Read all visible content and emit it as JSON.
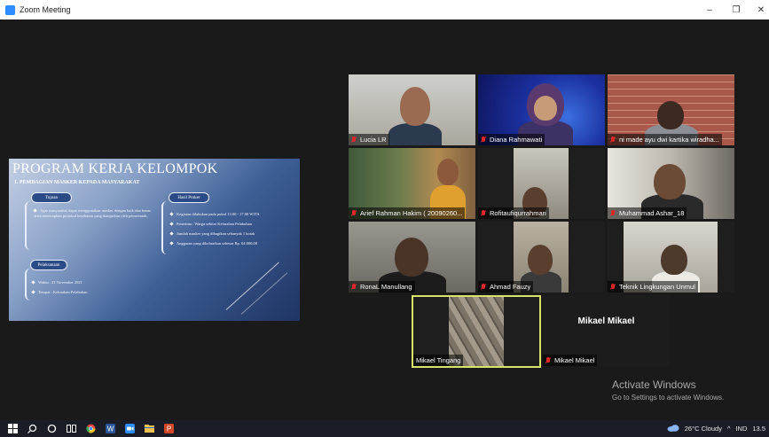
{
  "window": {
    "title": "Zoom Meeting",
    "controls": {
      "minimize": "–",
      "maximize": "❐",
      "close": "✕"
    }
  },
  "slide": {
    "heading": "PROGRAM KERJA KELOMPOK",
    "subheading": "1. PEMBAGIAN MASKER KEPADA MASYARAKAT",
    "tujuan_label": "Tujuan",
    "tujuan_text": "Agar masyarakat dapat menggunakan masker dengan baik dan benar serta menerapkan protokol kesehatan yang dianjurkan oleh pemerintah.",
    "pelaksanaan_label": "Pelaksanaan",
    "waktu": "Waktu       : 21 November 2021",
    "tempat": "Tempat      : Kelurahan Pelabuhan",
    "hasil_label": "Hasil Proker",
    "hasil_items": [
      "Kegiatan dilakukan pada pukul 13.00 - 17.00 WITA",
      "Penerima : Warga sekitar Kelurahan Pelabuhan",
      "Jumlah masker yang dibagikan sebanyak 1 kotak",
      "Anggaran yang dikeluarkan sebesar Rp. 64.000,00"
    ]
  },
  "participants": [
    {
      "name": "Lucia LR"
    },
    {
      "name": "Diana Rahmawati"
    },
    {
      "name": "ni made ayu dwi kartika wiradha..."
    },
    {
      "name": "Arief Rahman Hakim ( 20090260..."
    },
    {
      "name": "Rofitaufiqurrahman"
    },
    {
      "name": "Muhammad Ashar_18"
    },
    {
      "name": "RonaL Manullang"
    },
    {
      "name": "Ahmad Fauzy"
    },
    {
      "name": "Teknik Lingkungan Unmul"
    },
    {
      "name": "Mikael Tingang"
    },
    {
      "name": "Mikael Mikael",
      "display": "Mikael Mikael"
    }
  ],
  "watermark": {
    "line1": "Activate Windows",
    "line2": "Go to Settings to activate Windows."
  },
  "taskbar": {
    "weather": "26°C  Cloudy",
    "chevron": "^",
    "lang": "IND",
    "time": "13.5"
  },
  "colors": {
    "active_speaker": "#d8e36a",
    "muted_mic": "#e02828",
    "zoom_blue": "#2d8cff"
  }
}
